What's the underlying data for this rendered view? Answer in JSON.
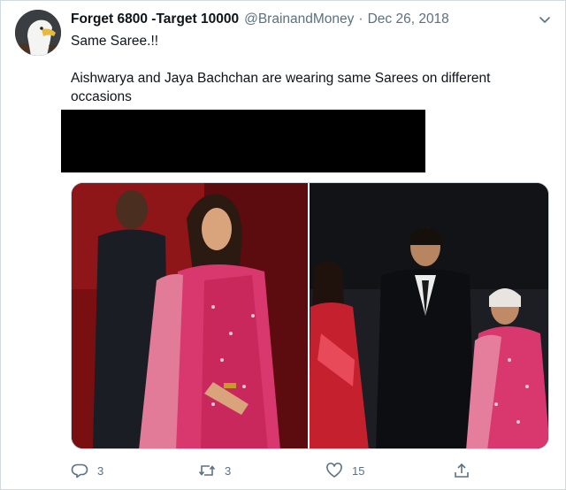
{
  "tweet": {
    "display_name": "Forget 6800 -Target 10000",
    "handle": "@BrainandMoney",
    "separator": "·",
    "date": "Dec 26, 2018",
    "text_line1": "Same Saree.!!",
    "text_line2": "Aishwarya and Jaya Bachchan are wearing same Sarees on different occasions",
    "avatar_icon": "eagle-icon",
    "media": {
      "description_icons": [
        "photo-left",
        "photo-right"
      ]
    },
    "actions": {
      "reply_count": "3",
      "retweet_count": "3",
      "like_count": "15"
    }
  },
  "colors": {
    "text_primary": "#0f1419",
    "text_secondary": "#5b7083",
    "border": "#cfd9de",
    "saree_pink": "#d8386e",
    "saree_red": "#c4202e"
  }
}
